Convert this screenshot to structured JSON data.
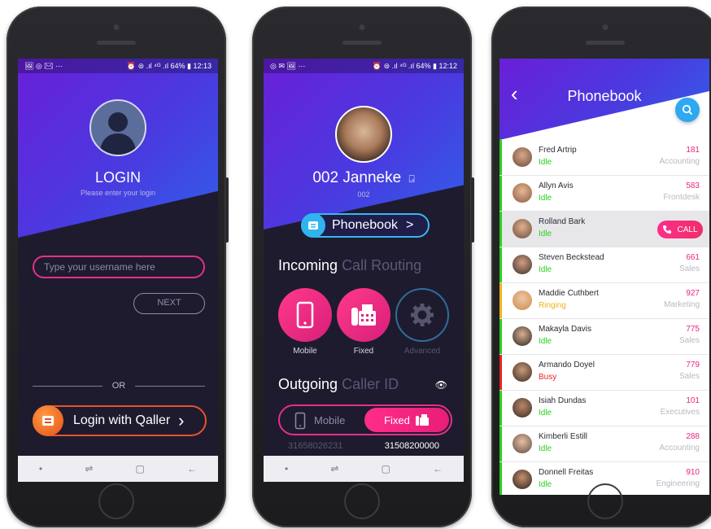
{
  "colors": {
    "accent_pink": "#e8257f",
    "accent_blue": "#2ea8f0",
    "idle": "#2bd01a",
    "ringing": "#f2b21a",
    "busy": "#e52321"
  },
  "login_screen": {
    "status_left": "🖼 ◎ ✉ ⋯",
    "status_right": "⏰ ⊜ .ıl ⁴ᴳ .ıl 64% ▮ 12:13",
    "title": "LOGIN",
    "subtitle": "Please enter your login",
    "username_placeholder": "Type your username here",
    "next_label": "NEXT",
    "or_label": "OR",
    "qaller_label": "Login with Qaller",
    "qaller_chevron": "›"
  },
  "profile_screen": {
    "status_left": "◎ ✉ 🖼 ⋯",
    "status_right": "⏰ ⊜ .ıl ⁴ᴳ .ıl 64% ▮ 12:12",
    "name": "002 Janneke",
    "extension": "002",
    "phonebook_label": "Phonebook",
    "phonebook_chevron": ">",
    "incoming_strong": "Incoming",
    "incoming_dim": "Call Routing",
    "routes": [
      {
        "label": "Mobile",
        "icon": "mobile-icon"
      },
      {
        "label": "Fixed",
        "icon": "desk-phone-icon"
      },
      {
        "label": "Advanced",
        "icon": "gear-icon"
      }
    ],
    "outgoing_strong": "Outgoing",
    "outgoing_dim": "Caller ID",
    "caller_mobile": "Mobile",
    "caller_fixed": "Fixed",
    "mobile_number": "31658026231",
    "fixed_number": "31508200000"
  },
  "phonebook_screen": {
    "title": "Phonebook",
    "call_label": "CALL",
    "contacts": [
      {
        "name": "Fred Artrip",
        "status": "Idle",
        "ext": "181",
        "dept": "Accounting"
      },
      {
        "name": "Allyn Avis",
        "status": "Idle",
        "ext": "583",
        "dept": "Frontdesk"
      },
      {
        "name": "Rolland Bark",
        "status": "Idle",
        "ext": "",
        "dept": ""
      },
      {
        "name": "Steven Beckstead",
        "status": "Idle",
        "ext": "661",
        "dept": "Sales"
      },
      {
        "name": "Maddie Cuthbert",
        "status": "Ringing",
        "ext": "927",
        "dept": "Marketing"
      },
      {
        "name": "Makayla Davis",
        "status": "Idle",
        "ext": "775",
        "dept": "Sales"
      },
      {
        "name": "Armando Doyel",
        "status": "Busy",
        "ext": "779",
        "dept": "Sales"
      },
      {
        "name": "Isiah Dundas",
        "status": "Idle",
        "ext": "101",
        "dept": "Executives"
      },
      {
        "name": "Kimberli Estill",
        "status": "Idle",
        "ext": "288",
        "dept": "Accounting"
      },
      {
        "name": "Donnell Freitas",
        "status": "Idle",
        "ext": "910",
        "dept": "Engineering"
      }
    ]
  }
}
